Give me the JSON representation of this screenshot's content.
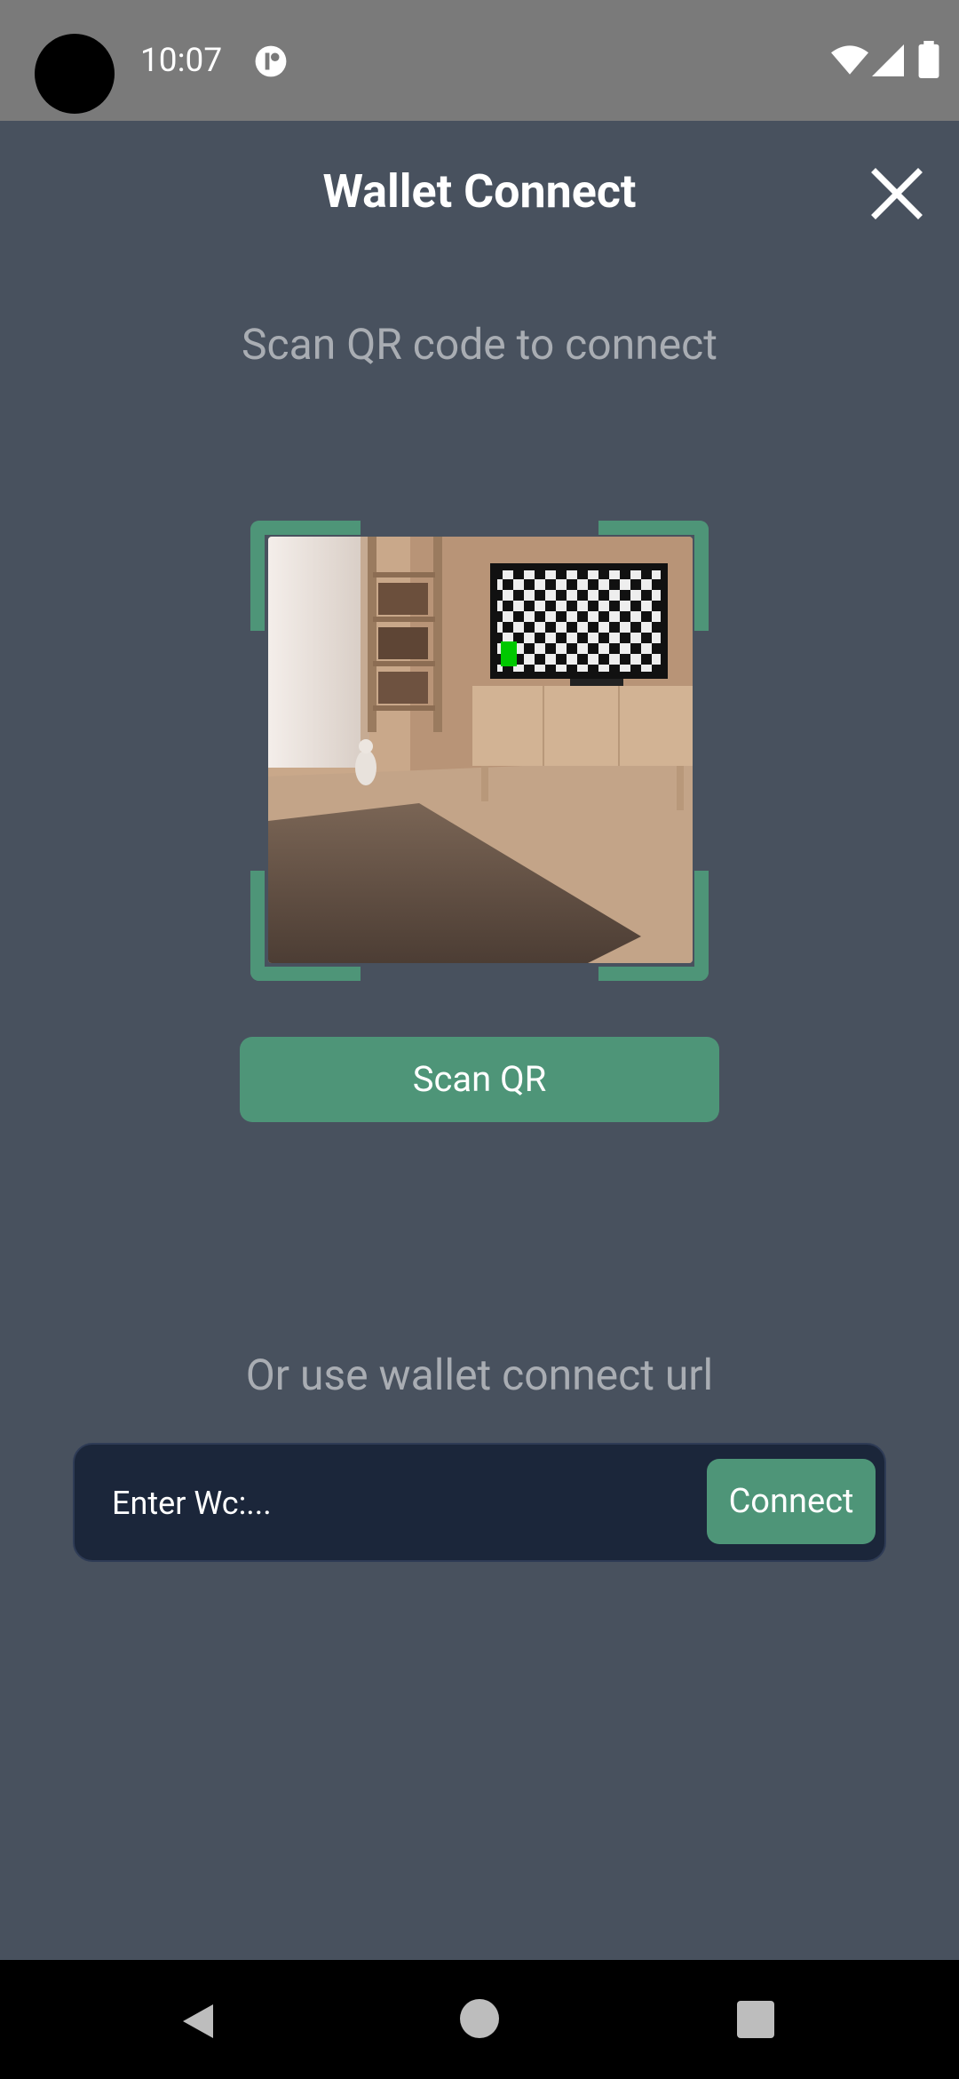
{
  "status_bar": {
    "time": "10:07",
    "icons": [
      "camera-dot",
      "notification-icon",
      "wifi-icon",
      "signal-icon",
      "battery-icon"
    ]
  },
  "header": {
    "title": "Wallet Connect",
    "close_icon": "close-icon"
  },
  "scan": {
    "instruction": "Scan QR code to connect",
    "button_label": "Scan QR",
    "frame_color": "#4e9578"
  },
  "url_section": {
    "label": "Or use wallet connect url",
    "input_placeholder": "Enter Wc:...",
    "input_value": "",
    "connect_label": "Connect"
  },
  "nav_bar": {
    "icons": [
      "back-icon",
      "home-icon",
      "recents-icon"
    ]
  },
  "colors": {
    "background": "#48515e",
    "accent": "#4e9578",
    "input_background": "#1b263a",
    "muted_text": "#a9adb3"
  }
}
